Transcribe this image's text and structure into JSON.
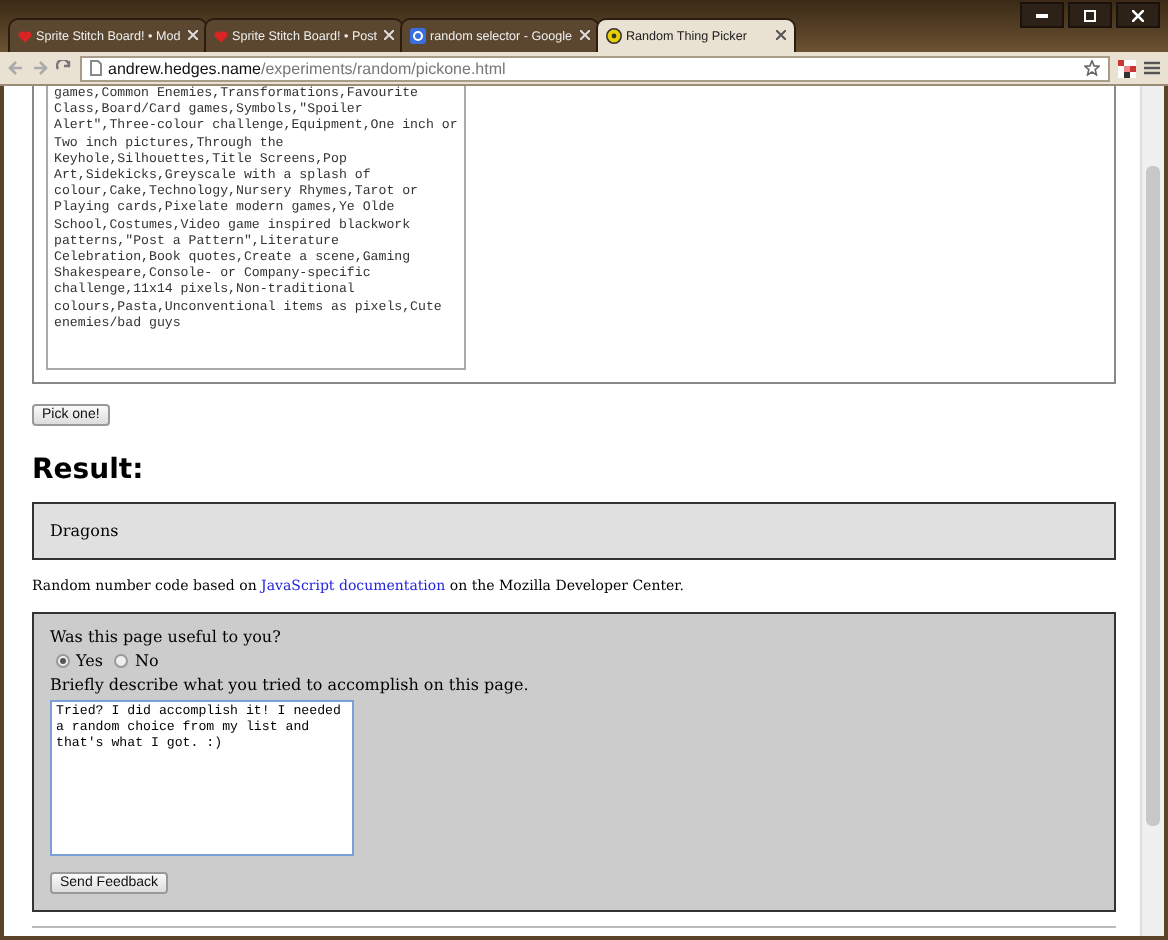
{
  "browser": {
    "tabs": [
      {
        "title": "Sprite Stitch Board! • Mod",
        "selected": false
      },
      {
        "title": "Sprite Stitch Board! • Post",
        "selected": false
      },
      {
        "title": "random selector - Google",
        "selected": false
      },
      {
        "title": "Random Thing Picker",
        "selected": true
      }
    ],
    "url_host": "andrew.hedges.name",
    "url_path": "/experiments/random/pickone.html"
  },
  "choices": {
    "value": "games,Common Enemies,Transformations,Favourite Class,Board/Card games,Symbols,\"Spoiler Alert\",Three-colour challenge,Equipment,One inch or Two inch pictures,Through the Keyhole,Silhouettes,Title Screens,Pop Art,Sidekicks,Greyscale with a splash of colour,Cake,Technology,Nursery Rhymes,Tarot or Playing cards,Pixelate modern games,Ye Olde School,Costumes,Video game inspired blackwork patterns,\"Post a Pattern\",Literature Celebration,Book quotes,Create a scene,Gaming Shakespeare,Console- or Company-specific challenge,11x14 pixels,Non-traditional colours,Pasta,Unconventional items as pixels,Cute enemies/bad guys"
  },
  "pick_button": "Pick one!",
  "result": {
    "heading": "Result:",
    "value": "Dragons"
  },
  "credit": {
    "before": "Random number code based on ",
    "link": "JavaScript documentation",
    "after": " on the Mozilla Developer Center."
  },
  "feedback": {
    "question": "Was this page useful to you?",
    "options": [
      {
        "label": "Yes",
        "selected": true
      },
      {
        "label": "No",
        "selected": false
      }
    ],
    "describe_label": "Briefly describe what you tried to accomplish on this page.",
    "answer": "Tried? I did accomplish it! I needed a random choice from my list and that's what I got. :)",
    "send_button": "Send Feedback"
  }
}
